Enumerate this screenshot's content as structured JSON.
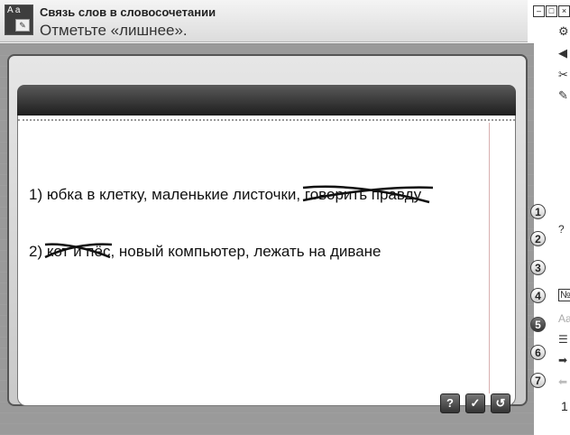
{
  "header": {
    "logo_text": "A a",
    "title": "Связь слов в словосочетании",
    "subtitle": "Отметьте «лишнее»."
  },
  "window_controls": {
    "minimize": "–",
    "restore": "□",
    "close": "×"
  },
  "exercise": {
    "line1": {
      "prefix": "1) юбка в клетку, маленькие листочки, ",
      "struck": "говорить правду"
    },
    "line2": {
      "prefix": "2) ",
      "struck": "кот и пёс",
      "suffix": ", новый компьютер, лежать на диване"
    }
  },
  "steps": [
    "1",
    "2",
    "3",
    "4",
    "5",
    "6",
    "7"
  ],
  "active_step": "5",
  "right_icons": {
    "q": "?",
    "no": "№",
    "aa": "Aa"
  },
  "page_number": "1",
  "buttons": {
    "hint": "?",
    "check": "✓",
    "reset": "↺"
  }
}
